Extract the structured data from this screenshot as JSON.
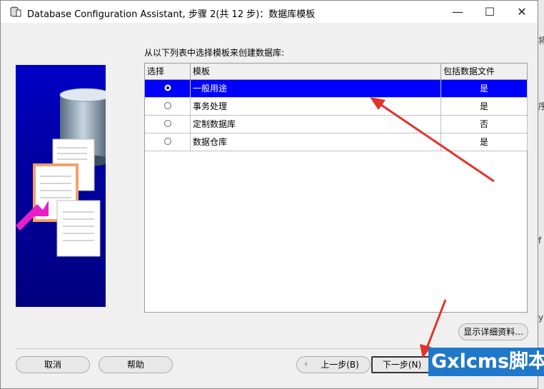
{
  "window": {
    "title": "Database Configuration Assistant, 步骤 2(共 12 步)：数据库模板",
    "minimize_glyph": "—",
    "maximize_glyph": "☐",
    "close_glyph": "✕"
  },
  "intro_text": "从以下列表中选择模板来创建数据库:",
  "table": {
    "headers": [
      "选择",
      "模板",
      "包括数据文件"
    ],
    "rows": [
      {
        "name": "一般用途",
        "includes": "是",
        "selected": true
      },
      {
        "name": "事务处理",
        "includes": "是",
        "selected": false
      },
      {
        "name": "定制数据库",
        "includes": "否",
        "selected": false
      },
      {
        "name": "数据仓库",
        "includes": "是",
        "selected": false
      }
    ]
  },
  "buttons": {
    "details": "显示详细资料...",
    "cancel": "取消",
    "help": "帮助",
    "back": "上一步(B)",
    "next": "下一步(N)"
  },
  "watermark": "Gxlcms脚本",
  "right_strip_chars": [
    "将",
    "序",
    "f",
    "ye"
  ],
  "colors": {
    "selection": "#0000ff",
    "annotation_arrow": "#e0332a",
    "side_panel": "#0000a0",
    "watermark_bg": "#1f78c9"
  },
  "icons": [
    "database-app-icon",
    "back-arrow-icon",
    "radio-button-icon",
    "annotation-arrow-icon"
  ]
}
